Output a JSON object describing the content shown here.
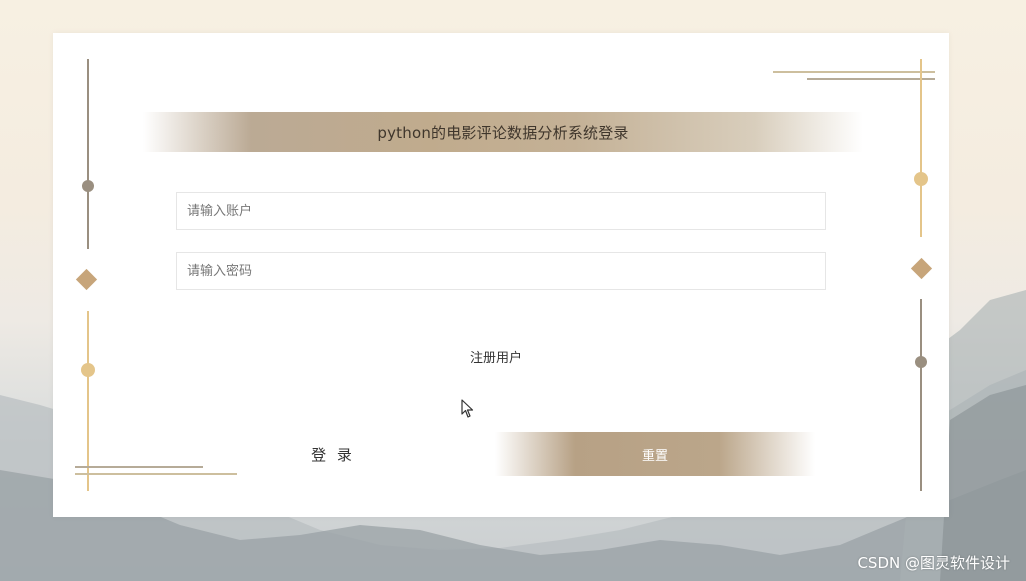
{
  "login": {
    "title": "python的电影评论数据分析系统登录",
    "account_placeholder": "请输入账户",
    "password_placeholder": "请输入密码",
    "register_link": "注册用户",
    "login_button": "登 录",
    "reset_button": "重置"
  },
  "watermark": "CSDN @图灵软件设计",
  "colors": {
    "accent_gold": "#e4c58a",
    "accent_tan": "#c7a57a",
    "accent_taupe": "#9a8f80",
    "title_bar": "#c0ab8d",
    "card_bg": "#ffffff"
  },
  "icons": {
    "cursor": "mouse-pointer-icon"
  }
}
